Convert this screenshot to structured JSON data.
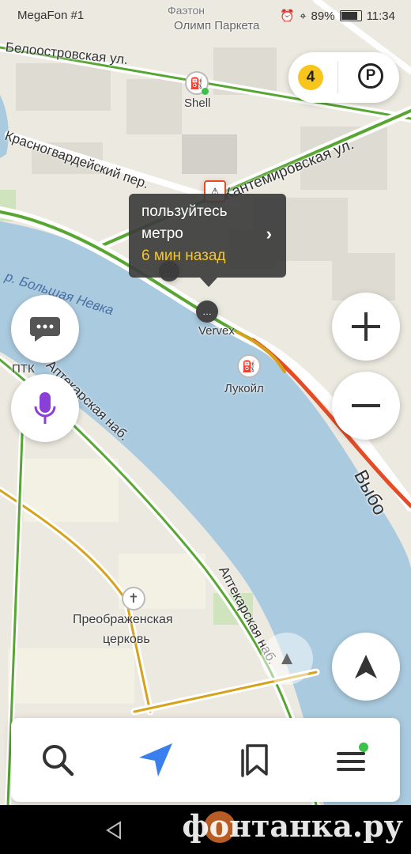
{
  "status_bar": {
    "carrier": "MegaFon #1",
    "battery": "89%",
    "time": "11:34"
  },
  "map": {
    "labels": {
      "faeton": "Фаэтон",
      "olimp": "Олимп Паркета",
      "beloostrovskaya": "Белоостровская ул.",
      "shell": "Shell",
      "krasnogvardeysky": "Красногвардейский пер.",
      "kantemirovskaya": "Кантемировская ул.",
      "river": "р. Большая Невка",
      "ptk": "ПТК",
      "vervex": "Vervex",
      "lukoil": "Лукойл",
      "aptekarskaya1": "Аптекарская наб.",
      "aptekarskaya2": "Аптекарская наб.",
      "vyborg": "Выбо",
      "church_line1": "Преображенская",
      "church_line2": "церковь"
    }
  },
  "popup": {
    "line1": "пользуйтесь",
    "line2": "метро",
    "time": "6 мин назад"
  },
  "controls": {
    "traffic_level": "4",
    "parking_label": "P"
  },
  "watermark": "фонтанка.ру",
  "colors": {
    "water": "#aacadf",
    "traffic_green": "#58a632",
    "traffic_yellow": "#d6a21b",
    "traffic_red": "#e34c26",
    "accent": "#3a7ff0",
    "mic": "#8a3fd6"
  }
}
